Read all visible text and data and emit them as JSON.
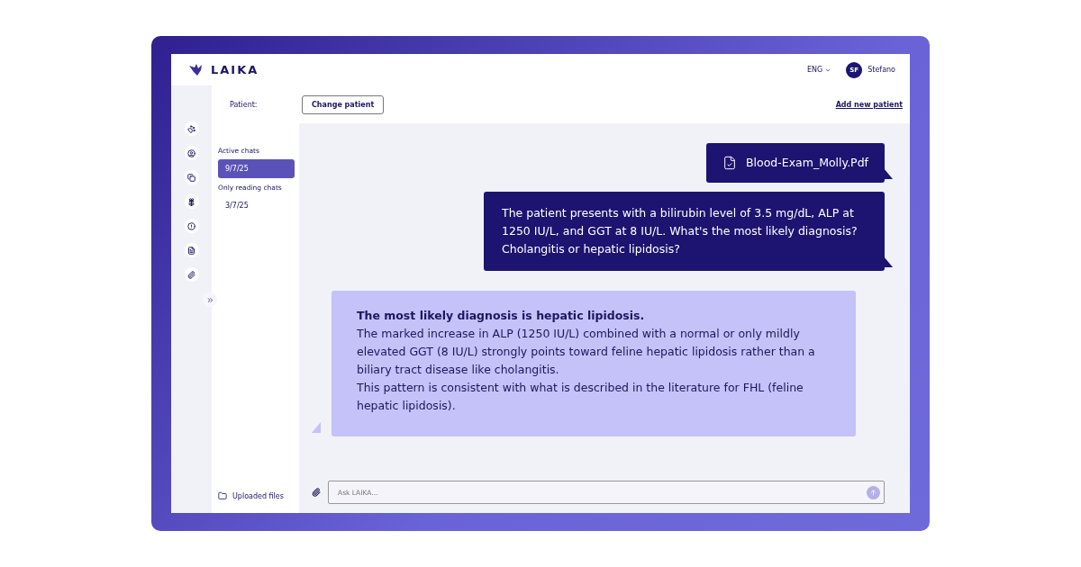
{
  "header": {
    "logo": "LAIKA",
    "language": "ENG",
    "user": {
      "initials": "SF",
      "name": "Stefano"
    }
  },
  "patient_bar": {
    "label": "Patient:",
    "change_button": "Change patient",
    "add_link": "Add new patient"
  },
  "chats": {
    "sections": [
      {
        "title": "Active chats",
        "items": [
          {
            "label": "9/7/25",
            "selected": true
          }
        ]
      },
      {
        "title": "Only reading chats",
        "items": [
          {
            "label": "3/7/25",
            "selected": false
          }
        ]
      }
    ],
    "uploaded_files": "Uploaded files"
  },
  "messages": [
    {
      "kind": "file",
      "file": "Blood-Exam_Molly.Pdf"
    },
    {
      "kind": "user",
      "text": "The patient presents with a bilirubin level of 3.5 mg/dL, ALP at 1250 IU/L, and GGT at 8 IU/L. What's the most likely diagnosis? Cholangitis or hepatic lipidosis?"
    },
    {
      "kind": "assistant",
      "paragraphs": [
        {
          "text": "The most likely diagnosis is hepatic lipidosis.",
          "bold": true
        },
        {
          "text": "The marked increase in ALP (1250 IU/L) combined with a normal or only mildly elevated GGT (8 IU/L) strongly points toward feline hepatic lipidosis rather than a biliary tract disease like cholangitis.",
          "bold": false
        },
        {
          "text": "This pattern is consistent with what is described in the literature for FHL (feline hepatic lipidosis).",
          "bold": false
        }
      ]
    }
  ],
  "composer": {
    "placeholder": "Ask LAIKA..."
  }
}
